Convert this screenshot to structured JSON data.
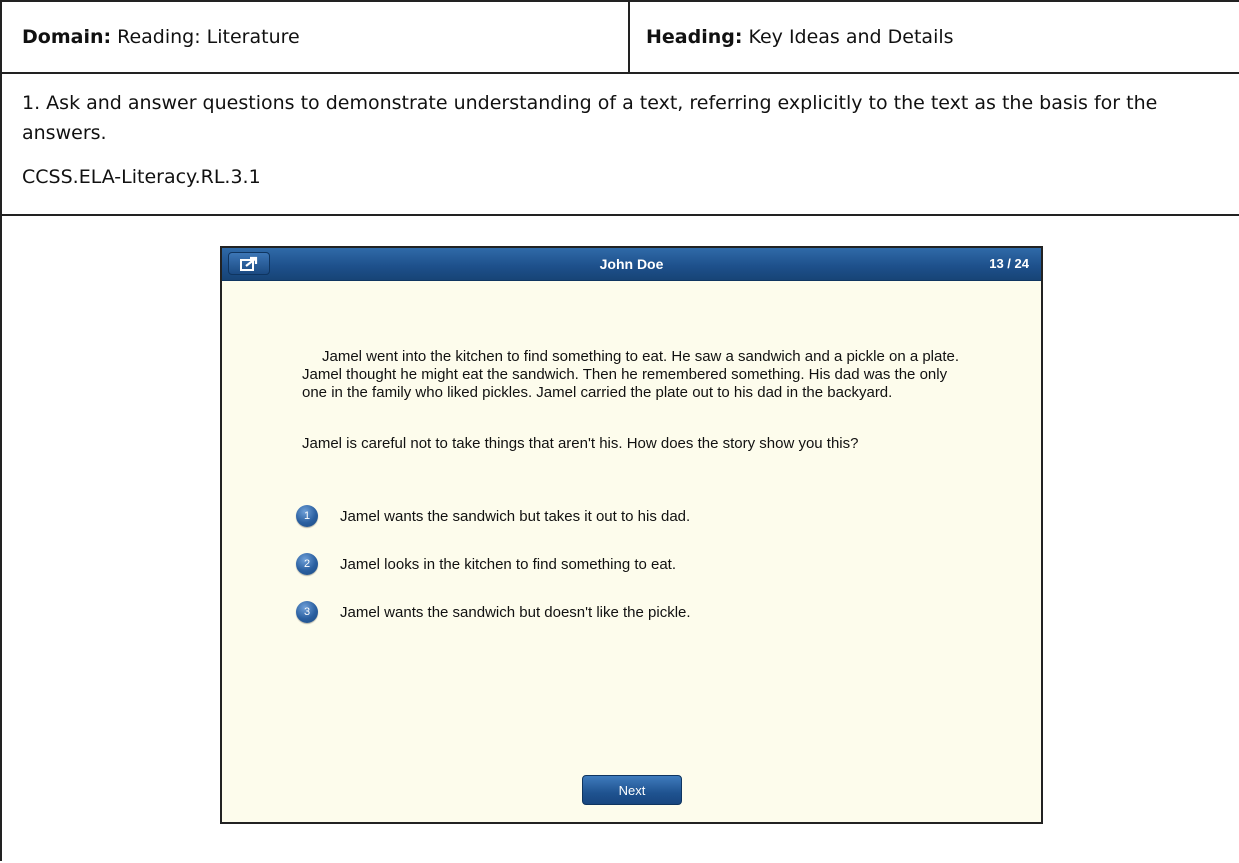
{
  "header": {
    "domain_label": "Domain:",
    "domain_value": "Reading: Literature",
    "heading_label": "Heading:",
    "heading_value": "Key Ideas and Details"
  },
  "standard": {
    "text": "1. Ask and answer questions to demonstrate understanding of a text, referring explicitly to the text as the basis for the answers.",
    "code": "CCSS.ELA-Literacy.RL.3.1"
  },
  "app": {
    "student_name": "John Doe",
    "counter": "13 / 24",
    "share_icon": "share-icon",
    "passage": "Jamel went into the kitchen to find something to eat. He saw a sandwich and a pickle on a plate. Jamel thought he might eat the sandwich. Then he remembered something. His dad was the only one in the family who liked pickles. Jamel carried the plate out to his dad in the backyard.",
    "question": "Jamel is careful not to take things that aren't his. How does the story show you this?",
    "options": [
      {
        "number": "1",
        "text": "Jamel wants the sandwich but takes it out to his dad."
      },
      {
        "number": "2",
        "text": "Jamel looks in the kitchen to find something to eat."
      },
      {
        "number": "3",
        "text": "Jamel wants the sandwich but doesn't like the pickle."
      }
    ],
    "next_label": "Next",
    "colors": {
      "bar": "#1d4f8a",
      "background": "#fdfcec",
      "option_badge": "#2a5fa0"
    }
  }
}
